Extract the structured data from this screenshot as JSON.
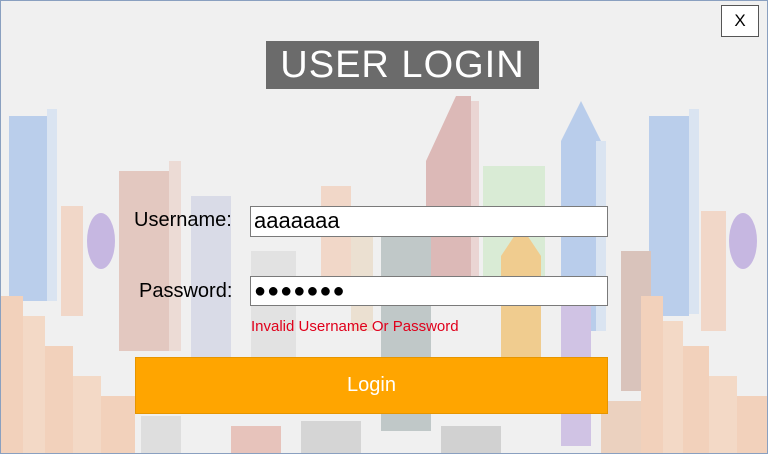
{
  "window": {
    "close_label": "X"
  },
  "header": {
    "title": "USER LOGIN"
  },
  "form": {
    "username_label": "Username:",
    "username_value": "aaaaaaa",
    "password_label": "Password:",
    "password_value": "●●●●●●●",
    "error_text": "Invalid Username Or Password",
    "login_label": "Login"
  },
  "colors": {
    "title_bg": "#6b6b6b",
    "button_bg": "#ffa500",
    "error_text": "#e0001b"
  }
}
